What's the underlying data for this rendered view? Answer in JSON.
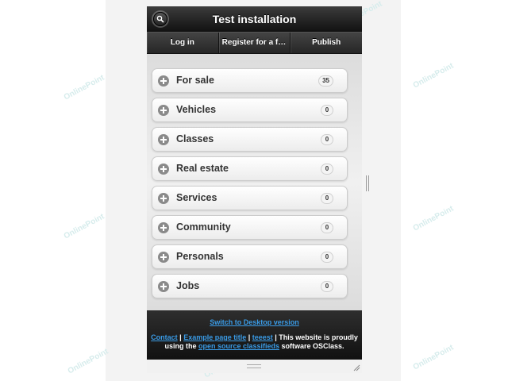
{
  "header": {
    "title": "Test installation",
    "search_icon": "search-icon"
  },
  "nav": [
    {
      "label": "Log in"
    },
    {
      "label": "Register for a free account"
    },
    {
      "label": "Publish"
    }
  ],
  "categories": [
    {
      "label": "For sale",
      "count": "35"
    },
    {
      "label": "Vehicles",
      "count": "0"
    },
    {
      "label": "Classes",
      "count": "0"
    },
    {
      "label": "Real estate",
      "count": "0"
    },
    {
      "label": "Services",
      "count": "0"
    },
    {
      "label": "Community",
      "count": "0"
    },
    {
      "label": "Personals",
      "count": "0"
    },
    {
      "label": "Jobs",
      "count": "0"
    }
  ],
  "footer": {
    "switch_label": "Switch to Desktop version",
    "contact": "Contact",
    "sep1": " | ",
    "example_page": "Example page title",
    "sep2": " | ",
    "teeest": "teeest",
    "tagline_pre": " | This website is proudly",
    "using": "using the ",
    "osc_link": "open source classifieds",
    "software": " software OSClass."
  },
  "watermark": "OnlinePoint"
}
